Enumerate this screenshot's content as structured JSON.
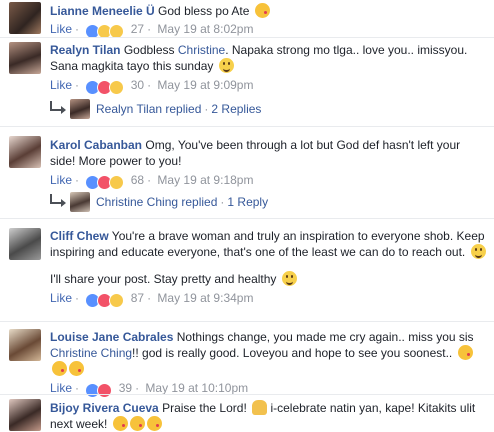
{
  "comments": [
    {
      "name": "Lianne Meneelie Ü",
      "text": "God bless po Ate",
      "like": "Like",
      "count": "27",
      "time": "May 19 at 8:02pm"
    },
    {
      "name": "Realyn Tilan",
      "text_a": "Godbless ",
      "mention": "Christine",
      "text_b": ". Napaka strong mo tlga.. love you.. imissyou. Sana magkita tayo this sunday",
      "like": "Like",
      "count": "30",
      "time": "May 19 at 9:09pm",
      "reply_name": "Realyn Tilan replied",
      "reply_count": "2 Replies"
    },
    {
      "name": "Karol Cabanban",
      "text": "Omg, You've been through a lot but God def hasn't left your side! More power to you!",
      "like": "Like",
      "count": "68",
      "time": "May 19 at 9:18pm",
      "reply_name": "Christine Ching replied",
      "reply_count": "1 Reply"
    },
    {
      "name": "Cliff Chew",
      "text": "You're a brave woman and truly an inspiration to everyone shob. Keep inspiring and educate everyone, that's one of the least we can do to reach out.",
      "text2": "I'll share your post. Stay pretty and healthy",
      "like": "Like",
      "count": "87",
      "time": "May 19 at 9:34pm"
    },
    {
      "name": "Louise Jane Cabrales",
      "text_a": "Nothings change, you made me cry again.. miss you sis ",
      "mention": "Christine Ching",
      "text_b": "!! god is really good. Loveyou and hope to see you soonest..",
      "like": "Like",
      "count": "39",
      "time": "May 19 at 10:10pm"
    },
    {
      "name": "Bijoy Rivera Cueva",
      "text_a": "Praise the Lord!",
      "text_b": " i-celebrate natin yan, kape! Kitakits ulit next week!"
    }
  ],
  "colors": {
    "link": "#365899",
    "meta": "#90949c",
    "like_reaction": "#5890ff",
    "love_reaction": "#f25268",
    "haha_reaction": "#f7c94b"
  },
  "icons": [
    "like-reaction-icon",
    "love-reaction-icon",
    "haha-reaction-icon",
    "smile-emoji-icon",
    "kiss-emoji-icon",
    "pray-emoji-icon",
    "reply-arrow-icon"
  ]
}
